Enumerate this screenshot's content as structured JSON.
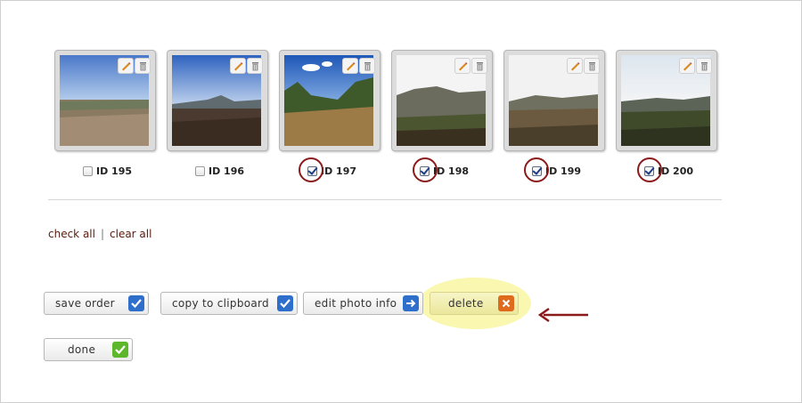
{
  "photos": [
    {
      "id_label": "ID 195",
      "checked": false
    },
    {
      "id_label": "ID 196",
      "checked": false
    },
    {
      "id_label": "ID 197",
      "checked": true
    },
    {
      "id_label": "ID 198",
      "checked": true
    },
    {
      "id_label": "ID 199",
      "checked": true
    },
    {
      "id_label": "ID 200",
      "checked": true
    }
  ],
  "links": {
    "check_all": "check all",
    "separator": "|",
    "clear_all": "clear all"
  },
  "buttons": {
    "save_order": "save order",
    "copy_to_clipboard": "copy to clipboard",
    "edit_photo_info": "edit photo info",
    "delete": "delete",
    "done": "done"
  },
  "icons": {
    "edit": "pencil-icon",
    "trash": "trash-icon",
    "save": "blue-check-icon",
    "copy": "blue-check-icon",
    "edit_info": "blue-arrow-icon",
    "delete": "orange-x-icon",
    "done": "green-check-icon"
  },
  "colors": {
    "highlight": "#f9f7b0",
    "annotation": "#8b1a1a",
    "link": "#5a1a0d"
  }
}
